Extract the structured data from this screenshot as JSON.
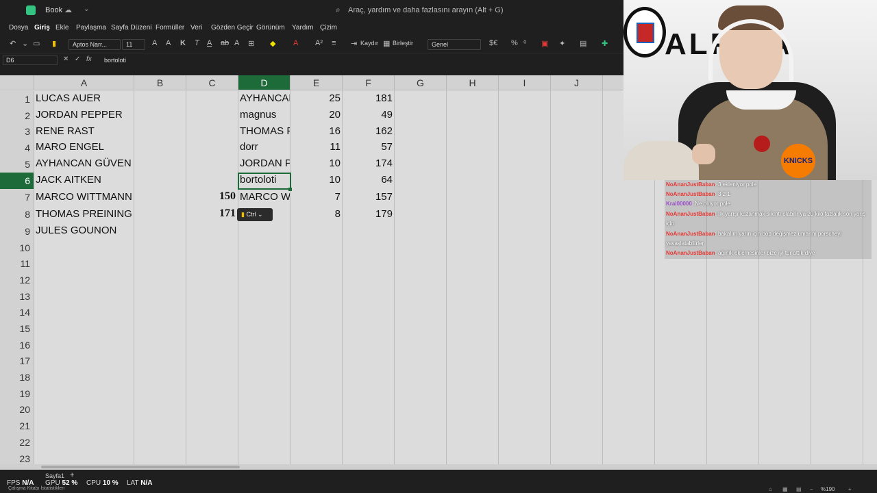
{
  "titlebar": {
    "book_title": "Book",
    "search_placeholder": "Araç, yardım ve daha fazlasını arayın (Alt + G)"
  },
  "menu": [
    "Dosya",
    "Giriş",
    "Ekle",
    "Paylaşma",
    "Sayfa Düzeni",
    "Formüller",
    "Veri",
    "Gözden Geçir",
    "Görünüm",
    "Yardım",
    "Çizim"
  ],
  "ribbon": {
    "font_name": "Aptos Narr...",
    "font_size": "11",
    "wrap_label": "Kaydır",
    "merge_label": "Birleştir",
    "number_format": "Genel"
  },
  "formula_bar": {
    "name_box": "D6",
    "fx": "fx",
    "content": "bortoloti"
  },
  "columns": [
    "A",
    "B",
    "C",
    "D",
    "E",
    "F",
    "G",
    "H",
    "I",
    "J"
  ],
  "rows": [
    "1",
    "2",
    "3",
    "4",
    "5",
    "6",
    "7",
    "8",
    "9",
    "10",
    "11",
    "12",
    "13",
    "14",
    "15",
    "16",
    "17",
    "18",
    "19",
    "20",
    "21",
    "22",
    "23"
  ],
  "cells": {
    "A": [
      "LUCAS AUER",
      "JORDAN PEPPER",
      "RENE RAST",
      "MARO ENGEL",
      "AYHANCAN GÜVEN",
      "JACK AITKEN",
      "MARCO WITTMANN",
      "THOMAS PREINING",
      "JULES GOUNON"
    ],
    "C": {
      "r7": "150",
      "r8": "171"
    },
    "D": [
      "AYHANCAN",
      "magnus",
      "THOMAS P",
      "dorr",
      "JORDAN P",
      "bortoloti",
      "MARCO W"
    ],
    "E": [
      "25",
      "20",
      "16",
      "11",
      "10",
      "10",
      "7",
      "8"
    ],
    "F": [
      "181",
      "49",
      "162",
      "57",
      "174",
      "64",
      "157",
      "179"
    ]
  },
  "ctrl_popup": "Ctrl",
  "webcam": {
    "banner_text": "ALPINA",
    "shirt_text": "KNICKS"
  },
  "chat": [
    {
      "user": "NoAnanJustBaban",
      "text": ": 3 ekleniyor pole"
    },
    {
      "user": "NoAnanJustBaban",
      "text": ": 3 2 1"
    },
    {
      "user": "Kral00000",
      "text": ": Ne oluyor pole",
      "purple": true
    },
    {
      "user": "NoAnanJustBaban",
      "text": ": Ilk yarışı kazanmak sıkıntı olabilir ya 20 kilo fazlalık son yarış için"
    },
    {
      "user": "NoAnanJustBaban",
      "text": ": bakalım yarın için bop değişmez umarım porscheyi yavaşlatabilirler"
    },
    {
      "user": "NoAnanJustBaban",
      "text": ": ağırlık eklemesinler bize iyi tur attık diye"
    }
  ],
  "statusbar": {
    "sheet_tab": "Sayfa1",
    "workbook_stats": "Çalışma Kitabı İstatistikleri",
    "fps_label": "FPS",
    "fps_value": "N/A",
    "gpu_label": "GPU",
    "gpu_value": "52 %",
    "cpu_label": "CPU",
    "cpu_value": "10 %",
    "lat_label": "LAT",
    "lat_value": "N/A",
    "zoom": "%190"
  }
}
